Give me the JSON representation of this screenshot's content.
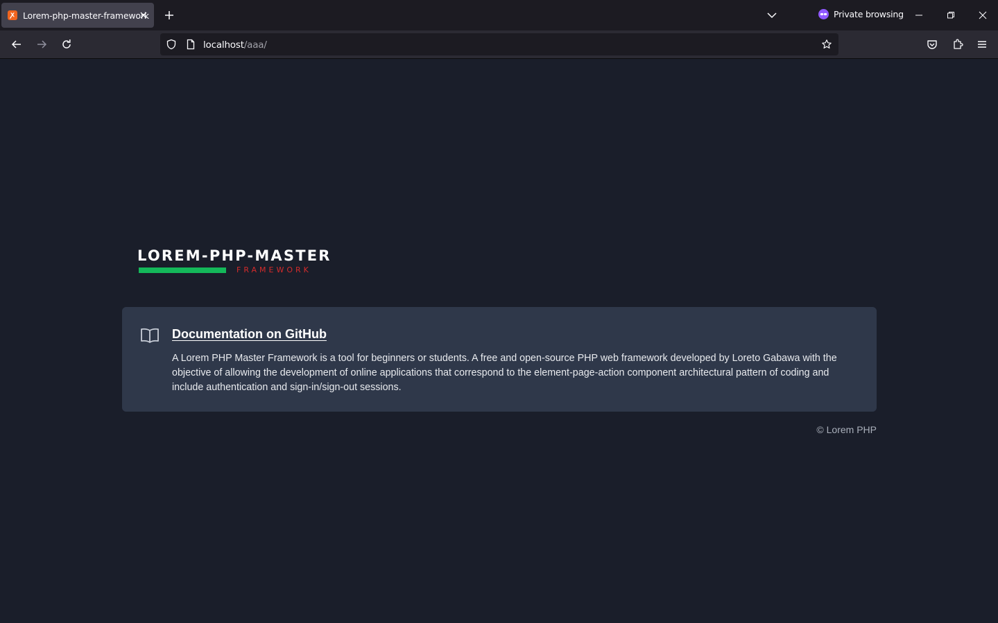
{
  "browser": {
    "tab": {
      "title": "Lorem-php-master-framework",
      "favicon": "xampp-icon"
    },
    "private_label": "Private browsing",
    "url": {
      "host": "localhost",
      "path": "/aaa/"
    }
  },
  "page": {
    "logo": {
      "main": "LOREM-PHP-MASTER",
      "sub": "FRAMEWORK"
    },
    "card": {
      "title": "Documentation on GitHub",
      "description": "A Lorem PHP Master Framework is a tool for beginners or students. A free and open-source PHP web framework developed by Loreto Gabawa with the objective of allowing the development of online applications that correspond to the element-page-action component architectural pattern of coding and include authentication and sign-in/sign-out sessions.",
      "icon": "book-icon"
    },
    "footer": "© Lorem PHP"
  },
  "colors": {
    "page_bg": "#1a1e2a",
    "card_bg": "#2f384a",
    "logo_green": "#14b85a",
    "logo_red": "#d42b2b",
    "private_purple": "#9059ff"
  }
}
